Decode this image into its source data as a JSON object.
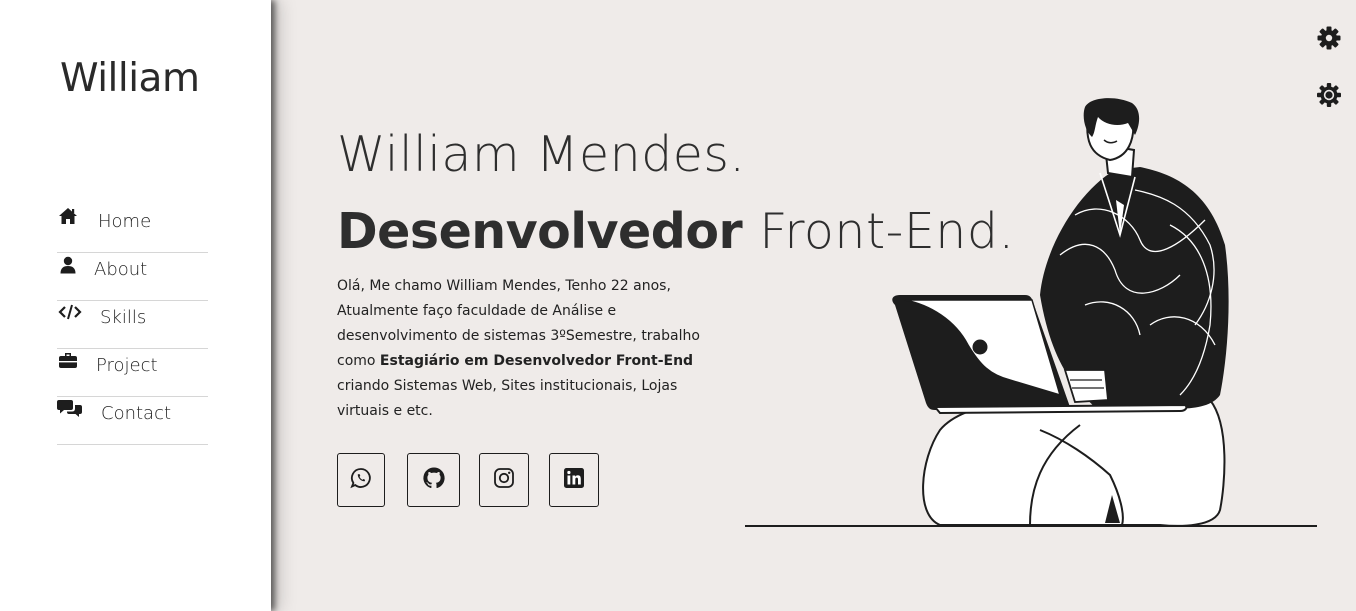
{
  "sidebar": {
    "brand": "William",
    "items": [
      {
        "label": "Home",
        "icon": "home-icon"
      },
      {
        "label": "About",
        "icon": "user-icon"
      },
      {
        "label": "Skills",
        "icon": "code-icon"
      },
      {
        "label": "Project",
        "icon": "briefcase-icon"
      },
      {
        "label": "Contact",
        "icon": "chat-icon"
      }
    ]
  },
  "hero": {
    "name": "William Mendes.",
    "role_bold": "Desenvolvedor",
    "role_light": "Front-End.",
    "bio_part1": "Olá, Me chamo William Mendes, Tenho 22 anos, Atualmente faço faculdade de Análise e desenvolvimento de sistemas 3ºSemestre, trabalho como ",
    "bio_bold": "Estagiário em Desenvolvedor Front-End",
    "bio_part2": " criando Sistemas Web, Sites institucionais, Lojas virtuais e etc."
  },
  "socials": [
    {
      "icon": "whatsapp-icon"
    },
    {
      "icon": "github-icon"
    },
    {
      "icon": "instagram-icon"
    },
    {
      "icon": "linkedin-icon"
    }
  ],
  "settings": [
    {
      "icon": "gear-icon"
    },
    {
      "icon": "theme-gear-icon"
    }
  ],
  "colors": {
    "background": "#efebe9",
    "sidebar": "#ffffff",
    "text": "#1d1d1d"
  }
}
